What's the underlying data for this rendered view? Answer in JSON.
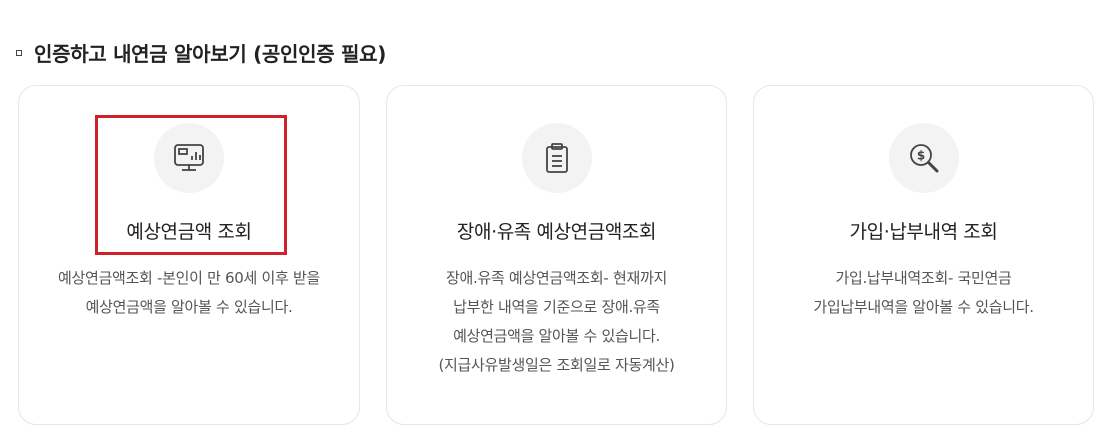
{
  "section": {
    "title": "인증하고 내연금 알아보기 (공인인증 필요)"
  },
  "cards": [
    {
      "title": "예상연금액 조회",
      "icon": "monitor-chart-icon",
      "desc": [
        "예상연금액조회 -본인이 만 60세 이후 받을",
        "예상연금액을 알아볼 수 있습니다."
      ]
    },
    {
      "title": "장애·유족 예상연금액조회",
      "icon": "clipboard-icon",
      "desc": [
        "장애.유족 예상연금액조회- 현재까지",
        "납부한 내역을 기준으로 장애.유족",
        "예상연금액을 알아볼 수 있습니다.",
        "(지급사유발생일은 조회일로 자동계산)"
      ]
    },
    {
      "title": "가입·납부내역 조회",
      "icon": "dollar-search-icon",
      "desc": [
        "가입.납부내역조회- 국민연금",
        "가입납부내역을 알아볼 수 있습니다."
      ]
    }
  ],
  "colors": {
    "highlight": "#d0202a",
    "card_border": "#e6e6e6",
    "icon_bg": "#f3f3f3"
  }
}
